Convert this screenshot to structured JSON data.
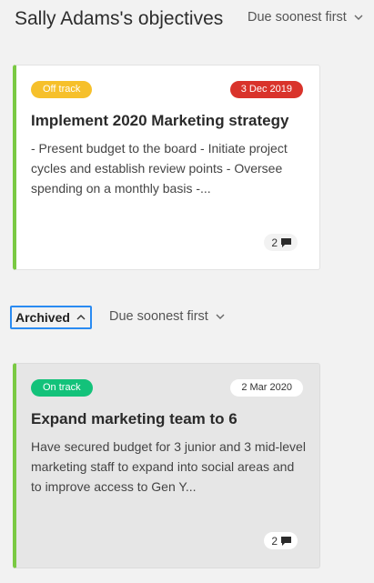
{
  "header": {
    "title": "Sally Adams's objectives",
    "sort_label": "Due soonest first",
    "sort_icon": "chevron-down-icon"
  },
  "objectives": [
    {
      "status": "Off track",
      "status_color": "#f6c02b",
      "due_date": "3 Dec 2019",
      "due_date_color": "#d9332b",
      "title": "Implement 2020 Marketing strategy",
      "description": "- Present budget to the board - Initiate project cycles and establish review points - Oversee spending on a monthly basis -...",
      "comment_count": "2",
      "accent_color": "#7ac943"
    }
  ],
  "archive_section": {
    "toggle_label": "Archived",
    "toggle_icon": "chevron-up-icon",
    "sort_label": "Due soonest first",
    "sort_icon": "chevron-down-icon"
  },
  "archived_objectives": [
    {
      "status": "On track",
      "status_color": "#13c27a",
      "due_date": "2 Mar 2020",
      "title": "Expand marketing team to 6",
      "description": "Have secured budget for 3 junior and 3 mid-level marketing staff to expand into social areas and to improve access to Gen Y...",
      "comment_count": "2",
      "accent_color": "#7ac943"
    }
  ]
}
